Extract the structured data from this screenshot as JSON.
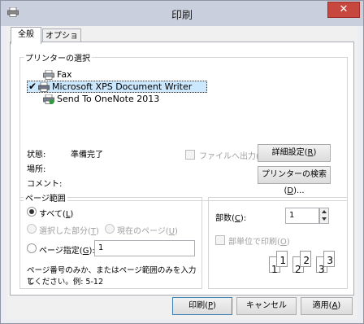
{
  "window": {
    "title": "印刷",
    "close_label": "✕"
  },
  "tabs": [
    {
      "label": "全般"
    },
    {
      "label": "オプション"
    }
  ],
  "printer_select": {
    "legend": "プリンターの選択",
    "printers": [
      {
        "name": "Fax"
      },
      {
        "name": "Microsoft XPS Document Writer"
      },
      {
        "name": "Send To OneNote 2013"
      }
    ]
  },
  "status": {
    "state_label": "状態:",
    "state_value": "準備完了",
    "location_label": "場所:",
    "comment_label": "コメント:"
  },
  "print_to_file": {
    "label_pre": "ファイルへ出力(",
    "key": "F",
    "label_post": ")"
  },
  "preferences_button": {
    "pre": "詳細設定(",
    "key": "R",
    "post": ")"
  },
  "find_printer_button": {
    "pre": "プリンターの検索(",
    "key": "D",
    "post": ")..."
  },
  "page_range": {
    "legend": "ページ範囲",
    "all": {
      "pre": "すべて(",
      "key": "L",
      "post": ")"
    },
    "selection": {
      "pre": "選択した部分(",
      "key": "T",
      "post": ")"
    },
    "current_page": {
      "pre": "現在のページ(",
      "key": "U",
      "post": ")"
    },
    "pages": {
      "pre": "ページ指定(",
      "key": "G",
      "post": "):"
    },
    "pages_value": "1",
    "hint_line1": "ページ番号のみか、またはページ範囲のみを入力し",
    "hint_line2": "てください。例: 5-12"
  },
  "copies": {
    "label_pre": "部数(",
    "key": "C",
    "label_post": "):",
    "value": "1",
    "collate": {
      "pre": "部単位で印刷(",
      "key": "O",
      "post": ")"
    },
    "collate_pages": [
      "1",
      "1",
      "2",
      "2",
      "3",
      "3"
    ]
  },
  "footer": {
    "print": {
      "pre": "印刷(",
      "key": "P",
      "post": ")"
    },
    "cancel": "キャンセル",
    "apply": {
      "pre": "適用(",
      "key": "A",
      "post": ")"
    }
  }
}
